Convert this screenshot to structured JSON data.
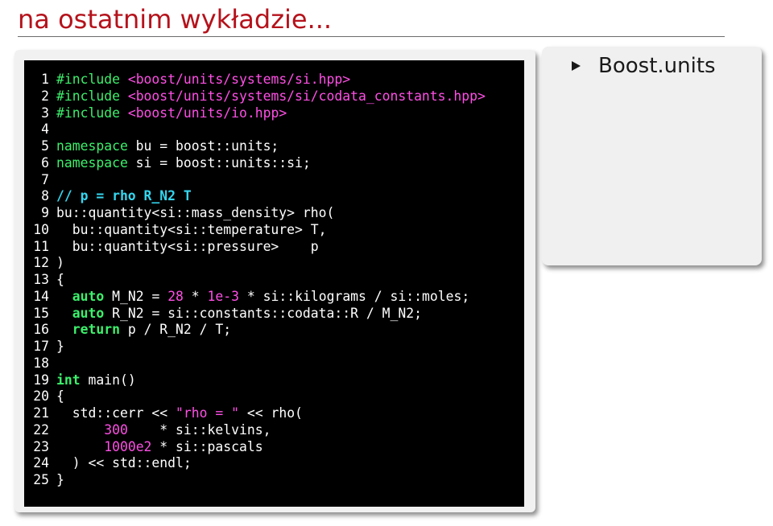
{
  "slide": {
    "title": "na ostatnim wykładzie..."
  },
  "bullets": [
    {
      "text": "Boost.units"
    }
  ],
  "code": {
    "lines": [
      {
        "number": "1",
        "segments": [
          {
            "text": "#include",
            "style": "ppkw"
          },
          {
            "text": " <boost/units/systems/si.hpp>",
            "style": "pp"
          }
        ]
      },
      {
        "number": "2",
        "segments": [
          {
            "text": "#include",
            "style": "ppkw"
          },
          {
            "text": " <boost/units/systems/si/codata_constants.hpp>",
            "style": "pp"
          }
        ]
      },
      {
        "number": "3",
        "segments": [
          {
            "text": "#include",
            "style": "ppkw"
          },
          {
            "text": " <boost/units/io.hpp>",
            "style": "pp"
          }
        ]
      },
      {
        "number": "4",
        "segments": []
      },
      {
        "number": "5",
        "segments": [
          {
            "text": "namespace",
            "style": "ppkw"
          },
          {
            "text": " bu = boost::units;",
            "style": "plain"
          }
        ]
      },
      {
        "number": "6",
        "segments": [
          {
            "text": "namespace",
            "style": "ppkw"
          },
          {
            "text": " si = boost::units::si;",
            "style": "plain"
          }
        ]
      },
      {
        "number": "7",
        "segments": []
      },
      {
        "number": "8",
        "segments": [
          {
            "text": "// p = rho R_N2 T",
            "style": "com"
          }
        ]
      },
      {
        "number": "9",
        "segments": [
          {
            "text": "bu::quantity<si::mass_density> rho(",
            "style": "plain"
          }
        ]
      },
      {
        "number": "10",
        "segments": [
          {
            "text": "  bu::quantity<si::temperature> T,",
            "style": "plain"
          }
        ]
      },
      {
        "number": "11",
        "segments": [
          {
            "text": "  bu::quantity<si::pressure>    p",
            "style": "plain"
          }
        ]
      },
      {
        "number": "12",
        "segments": [
          {
            "text": ")",
            "style": "plain"
          }
        ]
      },
      {
        "number": "13",
        "segments": [
          {
            "text": "{",
            "style": "plain"
          }
        ]
      },
      {
        "number": "14",
        "segments": [
          {
            "text": "  ",
            "style": "plain"
          },
          {
            "text": "auto",
            "style": "kw"
          },
          {
            "text": " M_N2 = ",
            "style": "plain"
          },
          {
            "text": "28",
            "style": "num"
          },
          {
            "text": " * ",
            "style": "plain"
          },
          {
            "text": "1e-3",
            "style": "num"
          },
          {
            "text": " * si::kilograms / si::moles;",
            "style": "plain"
          }
        ]
      },
      {
        "number": "15",
        "segments": [
          {
            "text": "  ",
            "style": "plain"
          },
          {
            "text": "auto",
            "style": "kw"
          },
          {
            "text": " R_N2 = si::constants::codata::R / M_N2;",
            "style": "plain"
          }
        ]
      },
      {
        "number": "16",
        "segments": [
          {
            "text": "  ",
            "style": "plain"
          },
          {
            "text": "return",
            "style": "kw"
          },
          {
            "text": " p / R_N2 / T;",
            "style": "plain"
          }
        ]
      },
      {
        "number": "17",
        "segments": [
          {
            "text": "}",
            "style": "plain"
          }
        ]
      },
      {
        "number": "18",
        "segments": []
      },
      {
        "number": "19",
        "segments": [
          {
            "text": "int",
            "style": "kw"
          },
          {
            "text": " main()",
            "style": "plain"
          }
        ]
      },
      {
        "number": "20",
        "segments": [
          {
            "text": "{",
            "style": "plain"
          }
        ]
      },
      {
        "number": "21",
        "segments": [
          {
            "text": "  std::cerr << ",
            "style": "plain"
          },
          {
            "text": "\"rho = \"",
            "style": "str"
          },
          {
            "text": " << rho(",
            "style": "plain"
          }
        ]
      },
      {
        "number": "22",
        "segments": [
          {
            "text": "      ",
            "style": "plain"
          },
          {
            "text": "300",
            "style": "num"
          },
          {
            "text": "    * si::kelvins,",
            "style": "plain"
          }
        ]
      },
      {
        "number": "23",
        "segments": [
          {
            "text": "      ",
            "style": "plain"
          },
          {
            "text": "1000e2",
            "style": "num"
          },
          {
            "text": " * si::pascals",
            "style": "plain"
          }
        ]
      },
      {
        "number": "24",
        "segments": [
          {
            "text": "  ) << std::endl;",
            "style": "plain"
          }
        ]
      },
      {
        "number": "25",
        "segments": [
          {
            "text": "}",
            "style": "plain"
          }
        ]
      }
    ]
  },
  "colors": {
    "title": "#b5121b",
    "code_background": "#000000",
    "keyword": "#3cf06b",
    "preprocessor": "#ff4fe6",
    "comment": "#35d7f0",
    "plain": "#ffffff"
  }
}
